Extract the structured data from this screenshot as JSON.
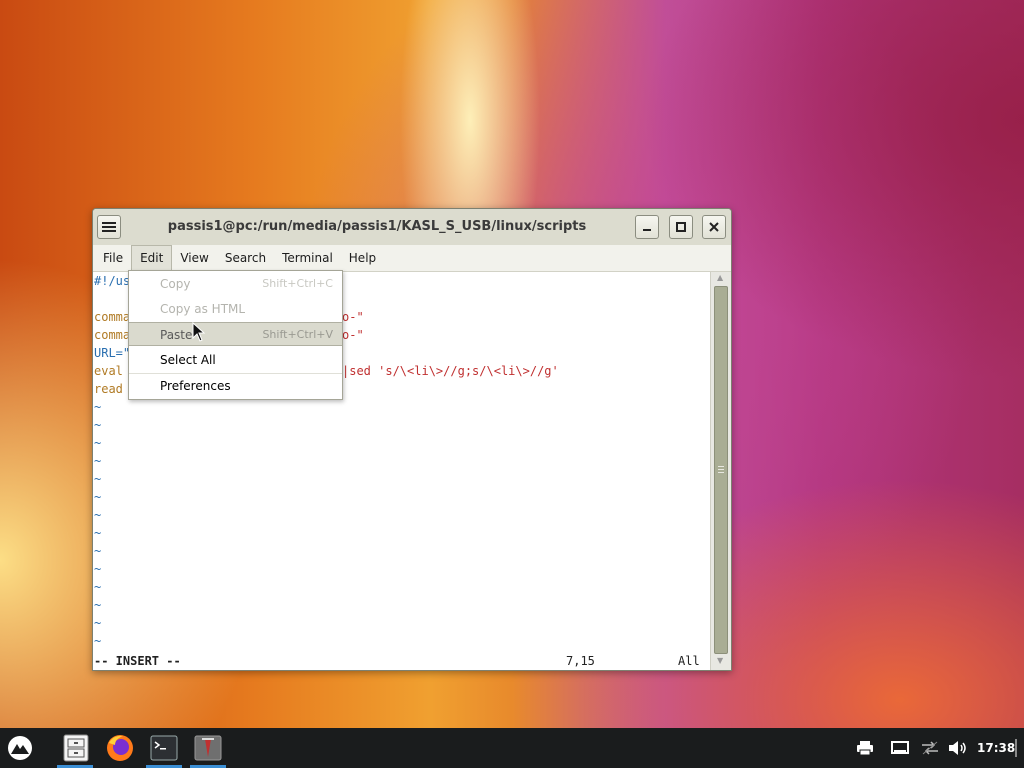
{
  "window": {
    "title": "passis1@pc:/run/media/passis1/KASL_S_USB/linux/scripts"
  },
  "menubar": {
    "items": [
      "File",
      "Edit",
      "View",
      "Search",
      "Terminal",
      "Help"
    ]
  },
  "edit_menu": {
    "items": [
      {
        "label": "Copy",
        "accel": "Shift+Ctrl+C",
        "enabled": false
      },
      {
        "label": "Copy as HTML",
        "accel": "",
        "enabled": false
      },
      {
        "label": "Paste",
        "accel": "Shift+Ctrl+V",
        "enabled": true,
        "hovered": true
      },
      {
        "label": "Select All",
        "accel": "",
        "enabled": true
      },
      {
        "label": "Preferences",
        "accel": "",
        "enabled": true
      }
    ]
  },
  "terminal": {
    "lines_visible": [
      {
        "left": "#!/us",
        "right": ""
      },
      {
        "left": "",
        "right": ""
      },
      {
        "left": "comma",
        "right": "o-\""
      },
      {
        "left": "comma",
        "right": "o-\""
      },
      {
        "left": "URL=\"",
        "right": ""
      },
      {
        "left": "eval",
        "right": "|sed 's/\\<li\\>//g;s/\\<li\\>//g'"
      },
      {
        "left": "read",
        "right": ""
      }
    ],
    "tilde": "~",
    "tilde_count": 14,
    "status_mode": "-- INSERT --",
    "status_pos": "7,15",
    "status_all": "All"
  },
  "taskbar": {
    "clock": "17:38",
    "apps": [
      "start-menu",
      "file-manager",
      "firefox",
      "terminal",
      "presentation"
    ]
  },
  "colors": {
    "titlebar": "#dcdccf",
    "scroll_thumb": "#a9ad94",
    "taskbar": "#1a1c1d",
    "accent": "#3b8fd5"
  }
}
